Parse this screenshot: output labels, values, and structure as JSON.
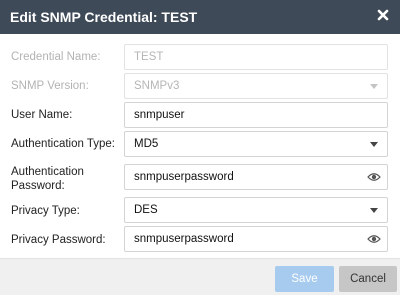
{
  "dialog": {
    "title": "Edit SNMP Credential: TEST",
    "close_icon": "close-icon"
  },
  "fields": {
    "credential_name": {
      "label": "Credential Name:",
      "value": "TEST",
      "disabled": true
    },
    "snmp_version": {
      "label": "SNMP Version:",
      "value": "SNMPv3",
      "disabled": true
    },
    "user_name": {
      "label": "User Name:",
      "value": "snmpuser"
    },
    "auth_type": {
      "label": "Authentication Type:",
      "value": "MD5"
    },
    "auth_password": {
      "label_line1": "Authentication",
      "label_line2": "Password:",
      "value": "snmpuserpassword",
      "icon": "eye-icon"
    },
    "privacy_type": {
      "label": "Privacy Type:",
      "value": "DES"
    },
    "privacy_password": {
      "label": "Privacy Password:",
      "value": "snmpuserpassword",
      "icon": "eye-icon"
    }
  },
  "footer": {
    "save_label": "Save",
    "cancel_label": "Cancel"
  },
  "colors": {
    "titlebar": "#3f4a58",
    "save_button": "#a7cbee",
    "cancel_button": "#c6c6c6"
  }
}
